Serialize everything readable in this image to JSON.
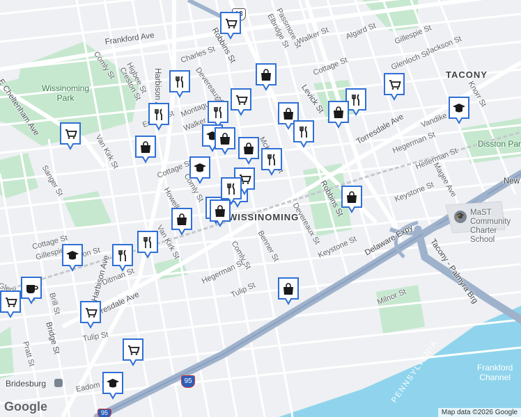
{
  "map": {
    "neighborhoods": [
      "TACONY",
      "WISSINOMING",
      "Bridesburg"
    ],
    "parks": [
      "Wissinoming Park",
      "Disston Park"
    ],
    "water": [
      "Frankford Channel"
    ],
    "school": "MaST Community Charter School",
    "highway_shields": [
      "13",
      "95",
      "95"
    ],
    "streets": [
      "Frankford Ave",
      "E Cheltenham Ave",
      "Comly St",
      "Higbee St",
      "Creston St",
      "Charles St",
      "Devereaux St",
      "Robbins St",
      "Passmore St",
      "Elbridge St",
      "Walker St",
      "Algard St",
      "Gillespie St",
      "Jackson St",
      "Glenloch St",
      "Cottage St",
      "Levick St",
      "Torresdale Ave",
      "Vandike St",
      "Knorr St",
      "Erdrick St",
      "Montague St",
      "Van Kirk St",
      "Sanger St",
      "McKinley St",
      "Hellerman St",
      "Hegerman St",
      "Magee Ave",
      "Keystone St",
      "Howell St",
      "Benner St",
      "Delaware Expy",
      "Milnor St",
      "Tacony - Palmyra Brg",
      "Harbison Ave",
      "Ditman St",
      "Tulip St",
      "Brill St",
      "Pratt St",
      "Eadom St",
      "Gillespie St",
      "Cottage St",
      "Glenloch St",
      "Jackson St",
      "Orthodox St",
      "Worth St",
      "Tulip St",
      "Mckinley St",
      "Anchor St",
      "Tyson Ave"
    ],
    "attribution": "Map data ©2026 Google",
    "logo": "Google",
    "colors": {
      "background": "#eef0f3",
      "park": "#c6e8cf",
      "water": "#8fd4ec",
      "highway": "#a8b7cc",
      "pin": "#2f6fd6"
    }
  },
  "labels": {
    "frankford_ave": "Frankford Ave",
    "cheltenham": "E Cheltenham Ave",
    "comly_top": "Comly St",
    "higbee": "Higbee St",
    "creston": "Creston St",
    "charles": "Charles St",
    "devereaux_top": "Devereaux St",
    "robbins_top": "Robbins St",
    "passmore": "Passmore St",
    "elbridge": "Elbridge St",
    "walker_top": "Walker St",
    "algard": "Algard St",
    "gillespie_top": "Gillespie St",
    "jackson_top": "Jackson St",
    "glenloch_top": "Glenloch St",
    "cottage_top": "Cottage St",
    "levick": "Levick St",
    "torresdale_r": "Torresdale Ave",
    "vandike": "Vandike St",
    "knorr": "Knorr St",
    "erdrick": "Erdrick St",
    "montague": "Montague St",
    "walker_mid": "Walker St",
    "vankirk_top": "Van Kirk St",
    "sanger": "Sanger St",
    "mckinley": "McKinley St",
    "hellerman": "Hellerman St",
    "hegerman_r": "Hegerman St",
    "magee": "Magee Ave",
    "keystone_r": "Keystone St",
    "cottage_mid": "Cottage St",
    "comly_mid": "Comly St",
    "howell": "Howell St",
    "robbins_mid": "Robbins St",
    "devereaux_mid": "Devereaux St",
    "keystone_mid": "Keystone St",
    "benner": "Benner St",
    "comly_low": "Comly St",
    "hegerman_low": "Hegerman St",
    "vankirk_low": "Van Kirk St",
    "cottage_low": "Cottage St",
    "gillespie_low": "Gillespie St",
    "jackson_low": "Jackson St",
    "glenloch_low": "Glenloch St",
    "harbison": "Harbison Ave",
    "ditman": "Ditman St",
    "torresdale_l": "Torresdale Ave",
    "tulip_mid": "Tulip St",
    "brill": "Brill St",
    "bridge_st": "Bridge St",
    "pratt": "Pratt St",
    "tulip_low": "Tulip St",
    "eadom": "Eadom St",
    "delaware": "Delaware Expy",
    "milnor": "Milnor St",
    "tacony_brg": "Tacony - Palmyra Brg",
    "new_state": "New State Rd",
    "harbison_top": "Harbison Ave",
    "wissinoming_park": "Wissinoming\nPark",
    "disston": "Disston Park",
    "tacony": "TACONY",
    "wissinoming": "WISSINOMING",
    "bridesburg": "Bridesburg",
    "frankford_channel": "Frankford\nChannel",
    "mast": "MaST Community\nCharter School",
    "pennsylvania": "PENNSYLVANIA",
    "shield13": "13",
    "shield95a": "95",
    "shield95b": "95",
    "attribution": "Map data ©2026",
    "logo": "Google"
  },
  "pins": [
    {
      "type": "cart",
      "name": "shopping-cart"
    },
    {
      "type": "restaurant",
      "name": "restaurant"
    },
    {
      "type": "bag",
      "name": "shopping-bag"
    },
    {
      "type": "cart",
      "name": "shopping-cart"
    },
    {
      "type": "restaurant",
      "name": "restaurant"
    },
    {
      "type": "cart",
      "name": "shopping-cart"
    },
    {
      "type": "bag",
      "name": "shopping-bag"
    },
    {
      "type": "restaurant",
      "name": "restaurant"
    },
    {
      "type": "bag",
      "name": "shopping-bag"
    },
    {
      "type": "school",
      "name": "school"
    },
    {
      "type": "cart",
      "name": "shopping-cart"
    },
    {
      "type": "restaurant",
      "name": "restaurant"
    },
    {
      "type": "restaurant",
      "name": "restaurant"
    },
    {
      "type": "school",
      "name": "school"
    },
    {
      "type": "bag",
      "name": "shopping-bag"
    },
    {
      "type": "bag",
      "name": "shopping-bag"
    },
    {
      "type": "restaurant",
      "name": "restaurant"
    },
    {
      "type": "school",
      "name": "school"
    },
    {
      "type": "bag",
      "name": "shopping-bag"
    },
    {
      "type": "restaurant",
      "name": "restaurant"
    },
    {
      "type": "cart",
      "name": "shopping-cart"
    },
    {
      "type": "bag",
      "name": "shopping-bag"
    },
    {
      "type": "bag",
      "name": "shopping-bag"
    },
    {
      "type": "restaurant",
      "name": "restaurant"
    },
    {
      "type": "bag",
      "name": "shopping-bag"
    },
    {
      "type": "restaurant",
      "name": "restaurant"
    },
    {
      "type": "school",
      "name": "school"
    },
    {
      "type": "restaurant",
      "name": "restaurant"
    },
    {
      "type": "coffee",
      "name": "cafe"
    },
    {
      "type": "cart",
      "name": "shopping-cart"
    },
    {
      "type": "cart",
      "name": "shopping-cart"
    },
    {
      "type": "bag",
      "name": "shopping-bag"
    },
    {
      "type": "cart",
      "name": "shopping-cart"
    },
    {
      "type": "school",
      "name": "school"
    },
    {
      "type": "bag",
      "name": "shopping-bag"
    }
  ]
}
